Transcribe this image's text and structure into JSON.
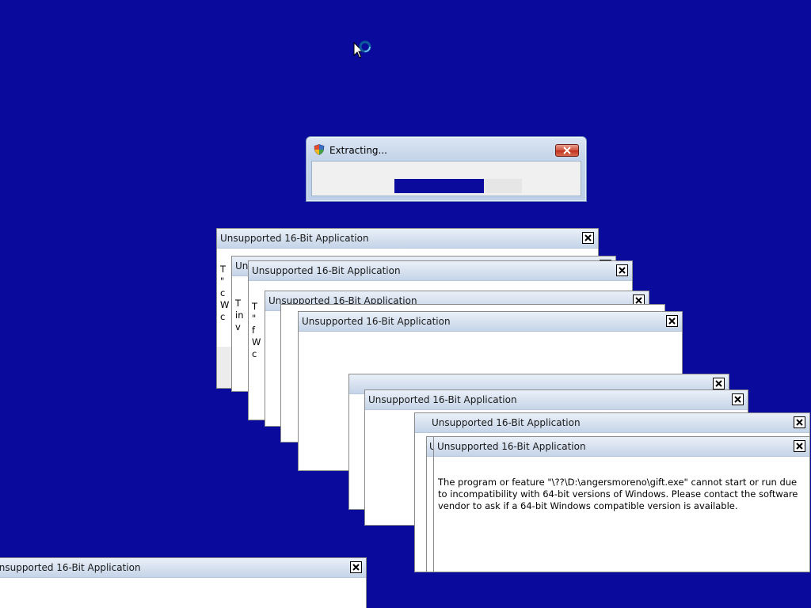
{
  "extracting": {
    "title": "Extracting...",
    "progress": 0.7,
    "progress_color": "#0a0a9c"
  },
  "dialog": {
    "title": "Unsupported 16-Bit Application",
    "title_clipped": "Unsupported 16-Bit Application",
    "title_cut_u": "Un",
    "title_cut_single": "U",
    "message": "The program or feature \"\\??\\D:\\angersmoreno\\gift.exe\" cannot start or run due to incompatibility with 64-bit versions of Windows. Please contact the software vendor to ask if a 64-bit Windows compatible version is available.",
    "message_partial_a": "T\n\"\nc\nW\nc",
    "message_partial_b": "T\nin\nv",
    "message_partial_c": "T\n\"\nf\nW\nc"
  },
  "desktop": {
    "background": "#0a0a9c"
  },
  "icons": {
    "cursor": "busy-cursor-icon",
    "shield": "uac-shield-icon",
    "close": "close-x-icon"
  }
}
